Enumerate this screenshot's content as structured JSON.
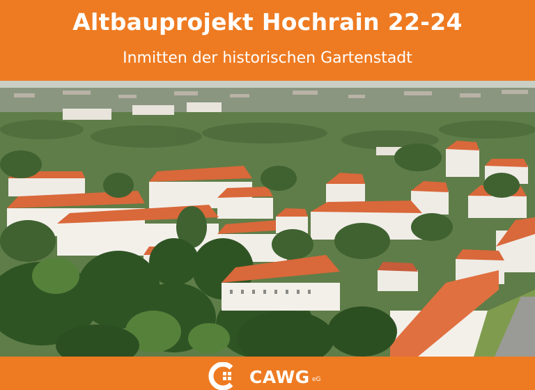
{
  "header": {
    "title": "Altbauprojekt Hochrain 22-24",
    "subtitle": "Inmitten der historischen Gartenstadt"
  },
  "footer": {
    "logo_text": "CAWG",
    "logo_suffix": "eG"
  },
  "colors": {
    "brand_orange": "#ee7b22",
    "roof_orange": "#d9683a",
    "text_white": "#ffffff"
  },
  "photo": {
    "icon": "aerial-photo-garden-city"
  }
}
